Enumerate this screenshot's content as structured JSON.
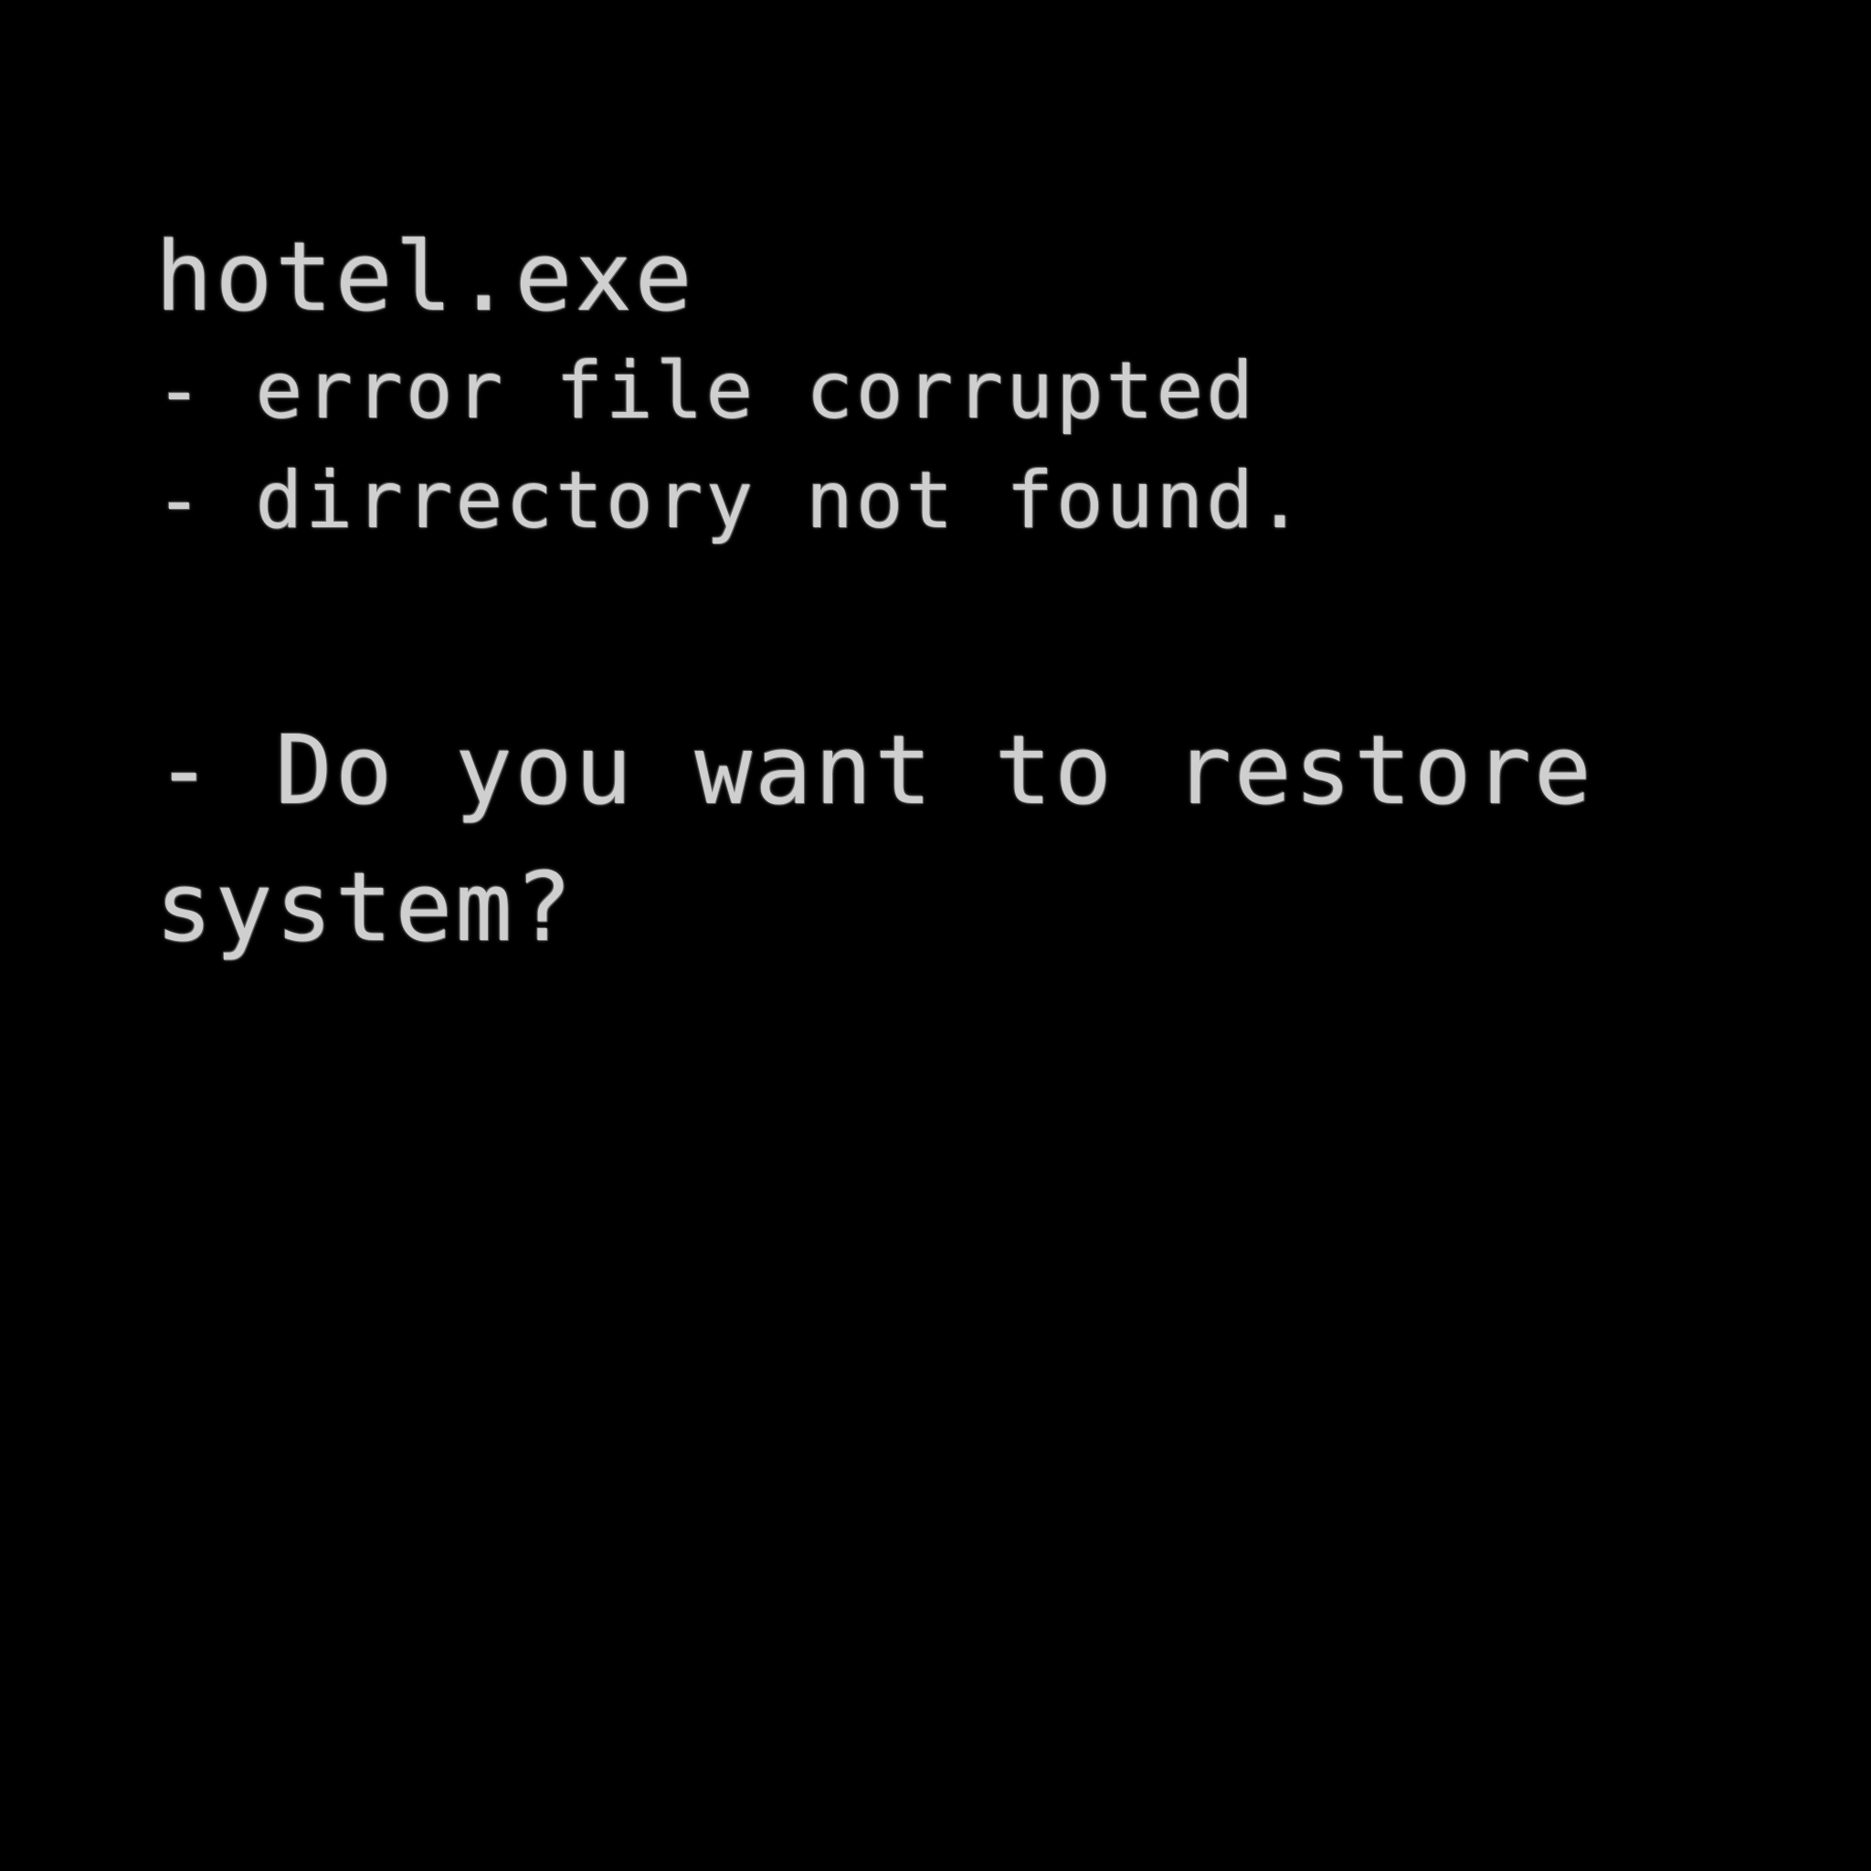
{
  "terminal": {
    "title": "hotel.exe",
    "messages": [
      "- error file corrupted",
      "- dirrectory not found."
    ],
    "prompt_line1": "- Do you want to restore",
    "prompt_line2": "system?"
  },
  "colors": {
    "background": "#000000",
    "text": "#cfcfcf"
  }
}
